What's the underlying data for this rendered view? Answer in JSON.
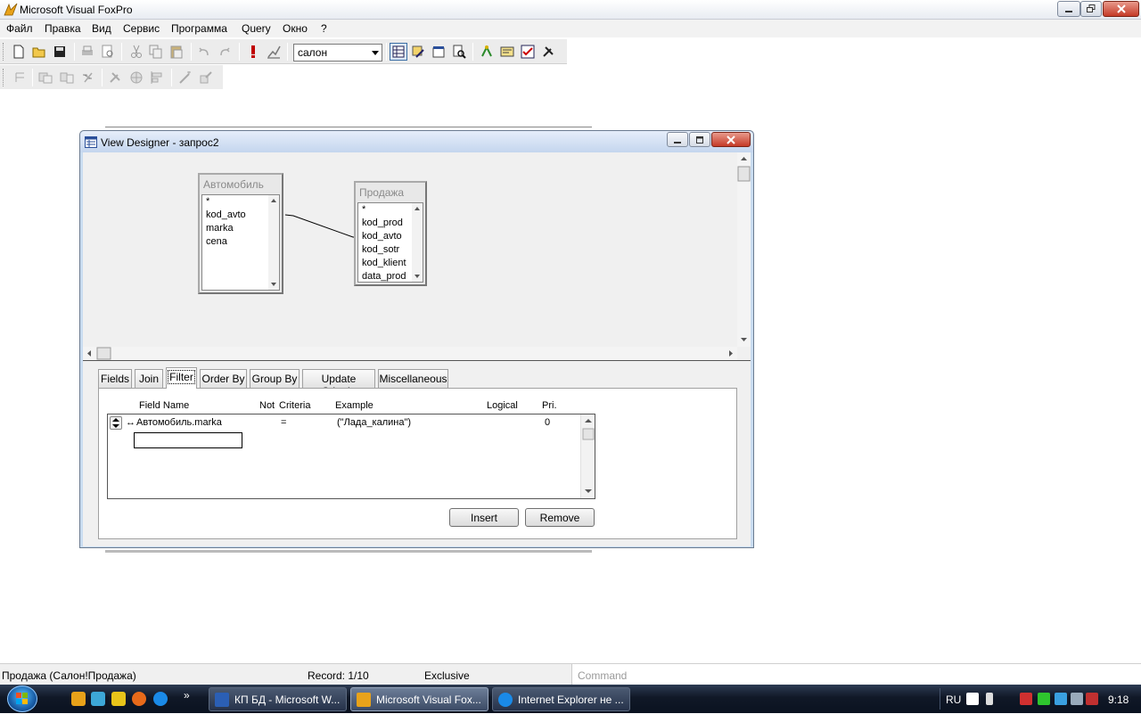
{
  "app": {
    "title": "Microsoft Visual FoxPro"
  },
  "menu": [
    "Файл",
    "Правка",
    "Вид",
    "Сервис",
    "Программа",
    "Query",
    "Окно",
    "?"
  ],
  "toolbar": {
    "database_select": "салон"
  },
  "view_designer": {
    "title": "View Designer - запрос2",
    "tables": [
      {
        "name": "Автомобиль",
        "fields": [
          "*",
          "kod_avto",
          "marka",
          "cena"
        ]
      },
      {
        "name": "Продажа",
        "fields": [
          "*",
          "kod_prod",
          "kod_avto",
          "kod_sotr",
          "kod_klient",
          "data_prod"
        ]
      }
    ],
    "tabs": [
      "Fields",
      "Join",
      "Filter",
      "Order By",
      "Group By",
      "Update Criteria",
      "Miscellaneous"
    ],
    "active_tab": "Filter",
    "filter": {
      "columns": {
        "field_name": "Field Name",
        "not": "Not",
        "criteria": "Criteria",
        "example": "Example",
        "logical": "Logical",
        "pri": "Pri."
      },
      "rows": [
        {
          "field": "Автомобиль.marka",
          "criteria": "=",
          "example": "(\"Лада_калина\")",
          "logical": "",
          "pri": "0"
        }
      ],
      "insert_button": "Insert",
      "remove_button": "Remove"
    }
  },
  "status": {
    "alias": "Продажа (Салон!Продажа)",
    "record": "Record: 1/10",
    "mode": "Exclusive",
    "command_placeholder": "Command"
  },
  "taskbar": {
    "tasks": [
      {
        "label": "КП БД - Microsoft W...",
        "active": false
      },
      {
        "label": "Microsoft Visual Fox...",
        "active": true
      },
      {
        "label": "Internet Explorer не ...",
        "active": false
      }
    ],
    "language": "RU",
    "clock": "9:18"
  },
  "colors": {
    "taskbar": "#101827",
    "window_frame": "#c9dcf0",
    "close_button": "#c53a27"
  }
}
